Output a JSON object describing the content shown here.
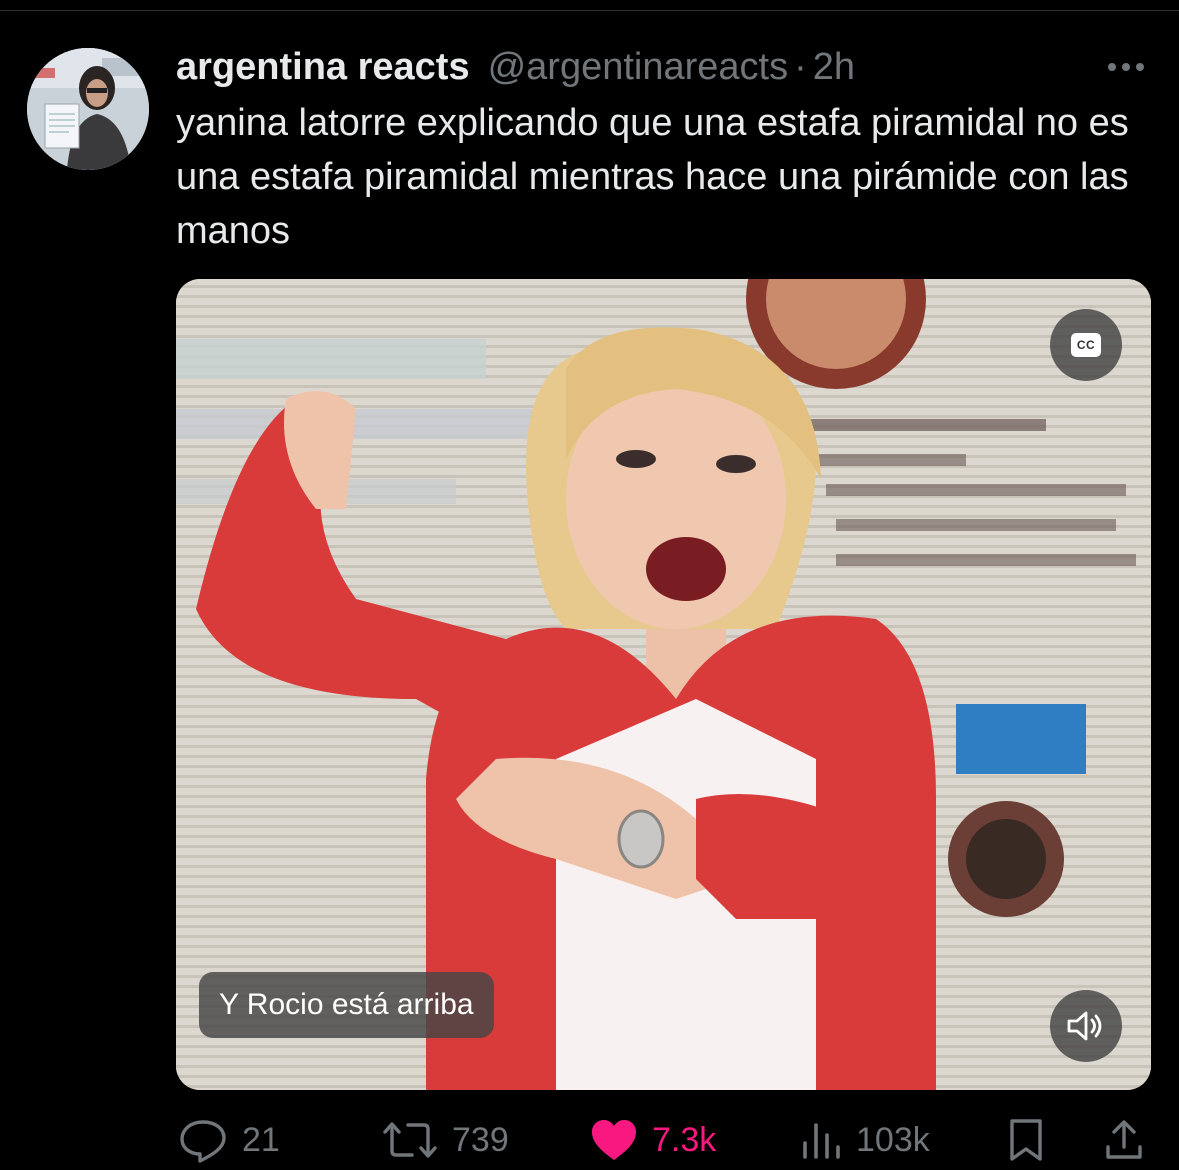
{
  "tweet": {
    "author_name": "argentina reacts",
    "author_handle": "@argentinareacts",
    "separator": "·",
    "time": "2h",
    "text": "yanina latorre explicando que una estafa piramidal no es una estafa piramidal mientras hace una pirámide con las manos"
  },
  "media": {
    "type": "video",
    "caption": "Y Rocio está arriba",
    "cc_label": "CC",
    "cc_icon": "closed-captions-icon",
    "volume_icon": "speaker-muted-icon"
  },
  "actions": {
    "replies": "21",
    "reposts": "739",
    "likes": "7.3k",
    "views": "103k",
    "like_state": "liked"
  },
  "colors": {
    "background": "#000000",
    "text_primary": "#e7e9ea",
    "text_secondary": "#71767b",
    "like_active": "#f91880"
  }
}
